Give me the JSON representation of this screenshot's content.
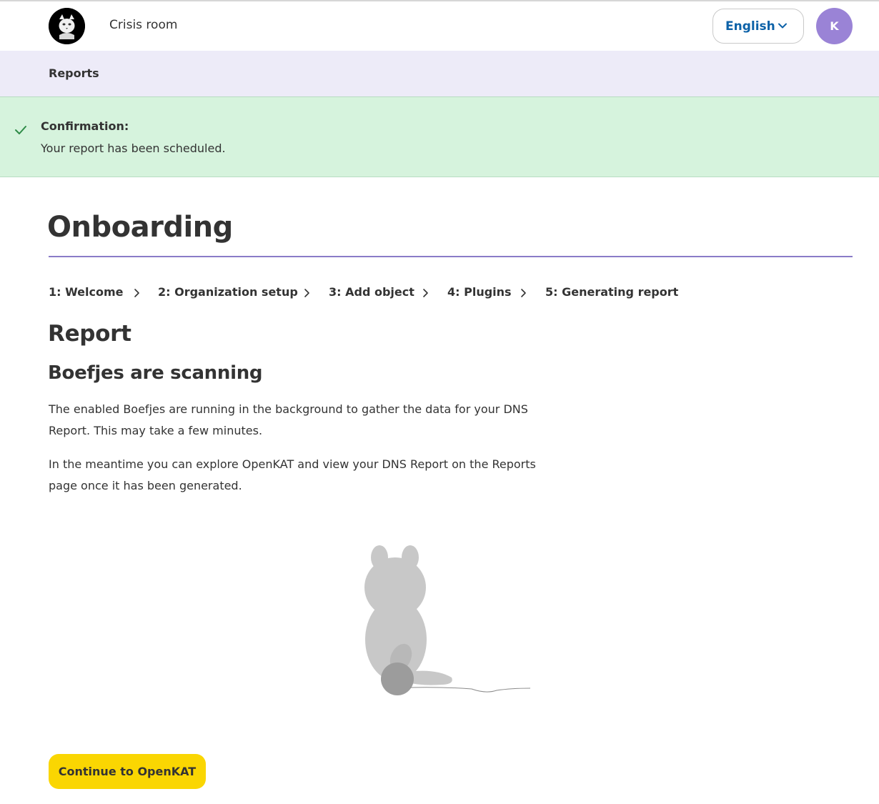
{
  "header": {
    "crisis_room": "Crisis room",
    "language": "English",
    "avatar_initial": "K"
  },
  "nav": {
    "reports": "Reports"
  },
  "confirmation": {
    "title": "Confirmation:",
    "message": "Your report has been scheduled."
  },
  "main": {
    "title": "Onboarding",
    "steps": [
      {
        "label": "1: Welcome"
      },
      {
        "label": "2: Organization setup"
      },
      {
        "label": "3: Add object"
      },
      {
        "label": "4: Plugins"
      },
      {
        "label": "5: Generating report"
      }
    ],
    "section_title": "Report",
    "subsection_title": "Boefjes are scanning",
    "paragraph_1": "The enabled Boefjes are running in the background to gather the data for your DNS Report. This may take a few minutes.",
    "paragraph_2": "In the meantime you can explore OpenKAT and view your DNS Report on the Reports page once it has been generated.",
    "continue_button": "Continue to OpenKAT"
  },
  "colors": {
    "accent_purple": "#8a7cc8",
    "nav_background": "#edebf8",
    "confirmation_background": "#d6f3dd",
    "button_yellow": "#fad602",
    "link_blue": "#0d62a8",
    "avatar_purple": "#9a83d6"
  },
  "icons": {
    "logo": "cat-logo-icon",
    "language_chevron": "chevron-down-icon",
    "confirmation": "check-icon",
    "step_separator": "chevron-right-icon",
    "illustration": "cat-with-yarn-illustration"
  }
}
